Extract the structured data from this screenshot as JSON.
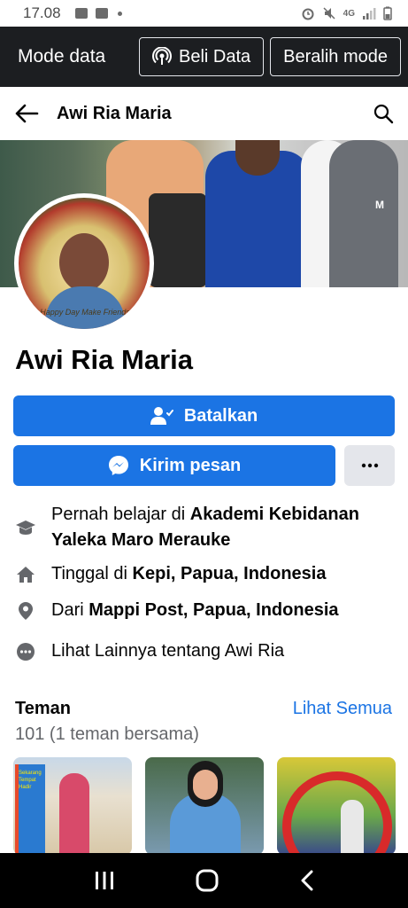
{
  "status_bar": {
    "time": "17.08",
    "network": "4G"
  },
  "data_bar": {
    "title": "Mode data",
    "buy_data_label": "Beli Data",
    "switch_mode_label": "Beralih mode"
  },
  "header": {
    "title": "Awi Ria Maria"
  },
  "cover_photo": {
    "shirt_text": "M"
  },
  "avatar": {
    "caption": "Happy Day Make Friends"
  },
  "profile": {
    "name": "Awi Ria Maria",
    "cancel_label": "Batalkan",
    "message_label": "Kirim pesan"
  },
  "info": {
    "education_prefix": "Pernah belajar di ",
    "education_place": "Akademi Kebidanan Yaleka Maro Merauke",
    "lives_prefix": "Tinggal di ",
    "lives_place": "Kepi, Papua, Indonesia",
    "from_prefix": "Dari ",
    "from_place": "Mappi Post, Papua, Indonesia",
    "see_more": "Lihat Lainnya tentang Awi Ria"
  },
  "friends": {
    "title": "Teman",
    "see_all": "Lihat Semua",
    "count": "101 (1 teman bersama)",
    "thumb1_sign": "Sekarang Tempat Hadir"
  },
  "colors": {
    "accent": "#1b74e4",
    "dark_bar": "#1c1e21",
    "secondary_button": "#e4e6eb",
    "muted_text": "#65676b"
  }
}
